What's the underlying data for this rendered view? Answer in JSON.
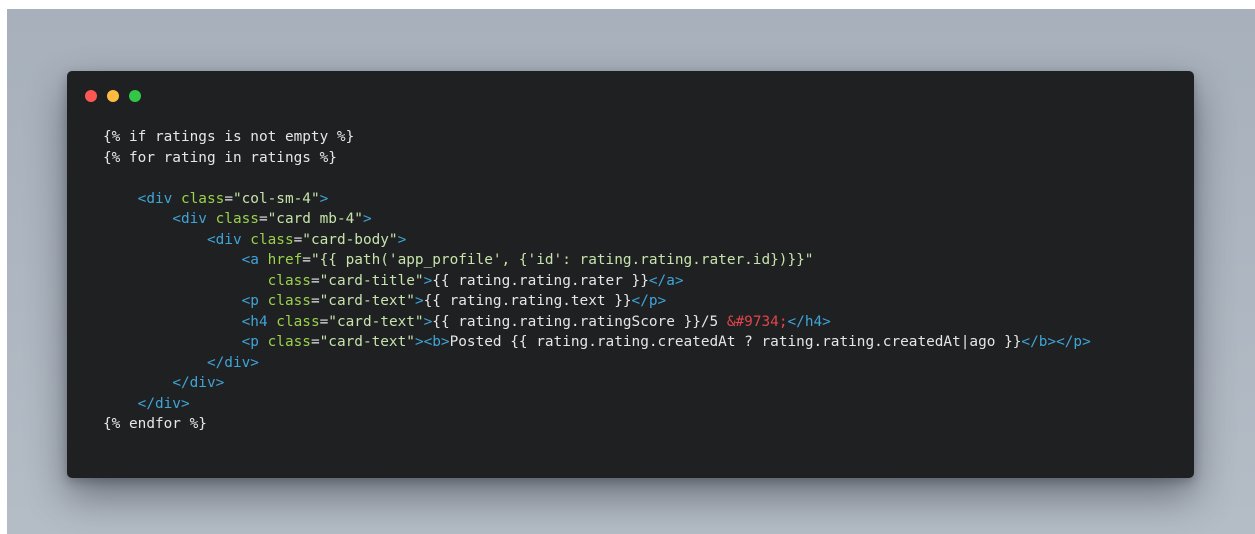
{
  "window": {
    "controls": [
      {
        "name": "close",
        "color": "#fc5753"
      },
      {
        "name": "minimize",
        "color": "#fdbc40"
      },
      {
        "name": "zoom",
        "color": "#33c748"
      }
    ]
  },
  "code_lines": [
    [
      {
        "t": "plain",
        "v": "{% if ratings is not empty %}"
      }
    ],
    [
      {
        "t": "plain",
        "v": "{% for rating in ratings %}"
      }
    ],
    [],
    [
      {
        "t": "plain",
        "v": "    "
      },
      {
        "t": "tag",
        "v": "<div"
      },
      {
        "t": "plain",
        "v": " "
      },
      {
        "t": "attr",
        "v": "class"
      },
      {
        "t": "plain",
        "v": "="
      },
      {
        "t": "str",
        "v": "\"col-sm-4\""
      },
      {
        "t": "tag",
        "v": ">"
      }
    ],
    [
      {
        "t": "plain",
        "v": "        "
      },
      {
        "t": "tag",
        "v": "<div"
      },
      {
        "t": "plain",
        "v": " "
      },
      {
        "t": "attr",
        "v": "class"
      },
      {
        "t": "plain",
        "v": "="
      },
      {
        "t": "str",
        "v": "\"card mb-4\""
      },
      {
        "t": "tag",
        "v": ">"
      }
    ],
    [
      {
        "t": "plain",
        "v": "            "
      },
      {
        "t": "tag",
        "v": "<div"
      },
      {
        "t": "plain",
        "v": " "
      },
      {
        "t": "attr",
        "v": "class"
      },
      {
        "t": "plain",
        "v": "="
      },
      {
        "t": "str",
        "v": "\"card-body\""
      },
      {
        "t": "tag",
        "v": ">"
      }
    ],
    [
      {
        "t": "plain",
        "v": "                "
      },
      {
        "t": "tag",
        "v": "<a"
      },
      {
        "t": "plain",
        "v": " "
      },
      {
        "t": "attr",
        "v": "href"
      },
      {
        "t": "plain",
        "v": "="
      },
      {
        "t": "str",
        "v": "\"{{ path('app_profile', {'id': rating.rating.rater.id})}}\""
      }
    ],
    [
      {
        "t": "plain",
        "v": "                   "
      },
      {
        "t": "attr",
        "v": "class"
      },
      {
        "t": "plain",
        "v": "="
      },
      {
        "t": "str",
        "v": "\"card-title\""
      },
      {
        "t": "tag",
        "v": ">"
      },
      {
        "t": "plain",
        "v": "{{ rating.rating.rater }}"
      },
      {
        "t": "tag",
        "v": "</a>"
      }
    ],
    [
      {
        "t": "plain",
        "v": "                "
      },
      {
        "t": "tag",
        "v": "<p"
      },
      {
        "t": "plain",
        "v": " "
      },
      {
        "t": "attr",
        "v": "class"
      },
      {
        "t": "plain",
        "v": "="
      },
      {
        "t": "str",
        "v": "\"card-text\""
      },
      {
        "t": "tag",
        "v": ">"
      },
      {
        "t": "plain",
        "v": "{{ rating.rating.text }}"
      },
      {
        "t": "tag",
        "v": "</p>"
      }
    ],
    [
      {
        "t": "plain",
        "v": "                "
      },
      {
        "t": "tag",
        "v": "<h4"
      },
      {
        "t": "plain",
        "v": " "
      },
      {
        "t": "attr",
        "v": "class"
      },
      {
        "t": "plain",
        "v": "="
      },
      {
        "t": "str",
        "v": "\"card-text\""
      },
      {
        "t": "tag",
        "v": ">"
      },
      {
        "t": "plain",
        "v": "{{ rating.rating.ratingScore }}/5 "
      },
      {
        "t": "ent",
        "v": "&#9734;"
      },
      {
        "t": "tag",
        "v": "</h4>"
      }
    ],
    [
      {
        "t": "plain",
        "v": "                "
      },
      {
        "t": "tag",
        "v": "<p"
      },
      {
        "t": "plain",
        "v": " "
      },
      {
        "t": "attr",
        "v": "class"
      },
      {
        "t": "plain",
        "v": "="
      },
      {
        "t": "str",
        "v": "\"card-text\""
      },
      {
        "t": "tag",
        "v": "><b>"
      },
      {
        "t": "plain",
        "v": "Posted {{ rating.rating.createdAt ? rating.rating.createdAt|ago }}"
      },
      {
        "t": "tag",
        "v": "</b></p>"
      }
    ],
    [
      {
        "t": "plain",
        "v": "            "
      },
      {
        "t": "tag",
        "v": "</div>"
      }
    ],
    [
      {
        "t": "plain",
        "v": "        "
      },
      {
        "t": "tag",
        "v": "</div>"
      }
    ],
    [
      {
        "t": "plain",
        "v": "    "
      },
      {
        "t": "tag",
        "v": "</div>"
      }
    ],
    [
      {
        "t": "plain",
        "v": "{% endfor %}"
      }
    ]
  ]
}
